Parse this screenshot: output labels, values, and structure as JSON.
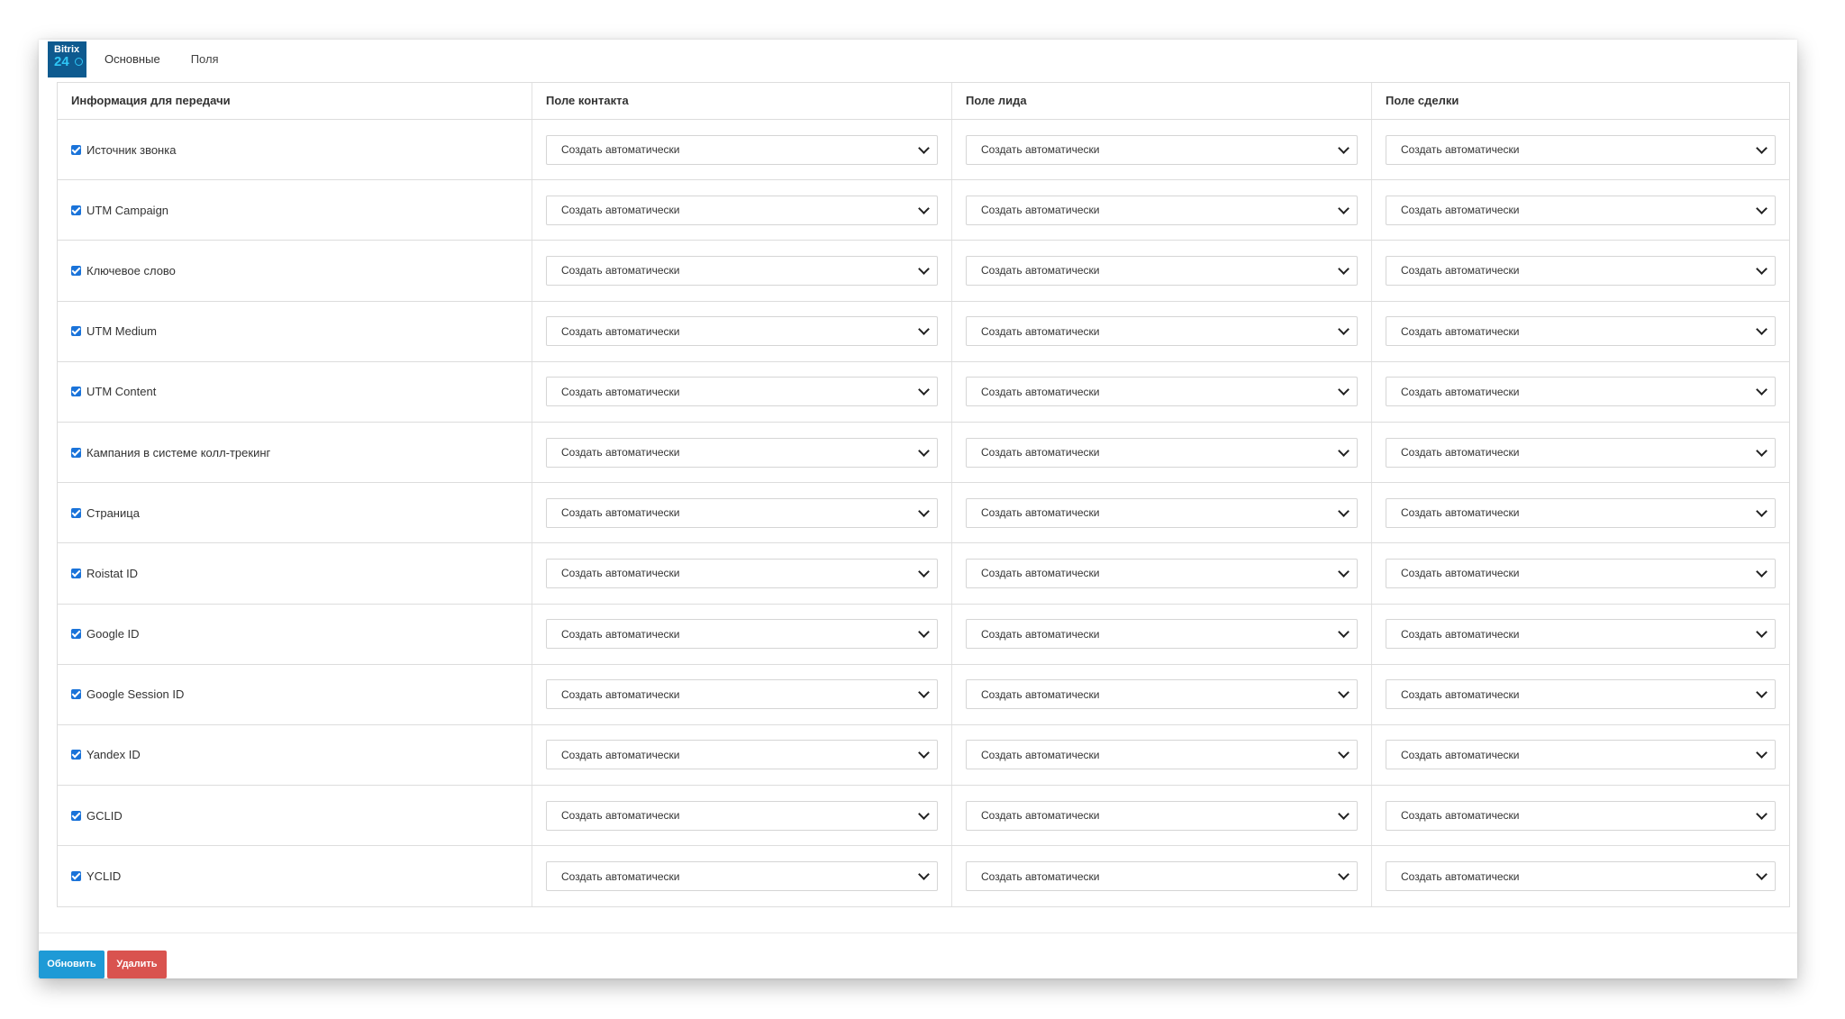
{
  "logo": {
    "line1": "Bitrix",
    "line2": "24"
  },
  "tabs": [
    {
      "label": "Основные"
    },
    {
      "label": "Поля"
    }
  ],
  "table": {
    "headers": [
      "Информация для передачи",
      "Поле контакта",
      "Поле лида",
      "Поле сделки"
    ],
    "rows": [
      {
        "label": "Источник звонка",
        "checked": true,
        "contact": "Создать автоматически",
        "lead": "Создать автоматически",
        "deal": "Создать автоматически"
      },
      {
        "label": "UTM Campaign",
        "checked": true,
        "contact": "Создать автоматически",
        "lead": "Создать автоматически",
        "deal": "Создать автоматически"
      },
      {
        "label": "Ключевое слово",
        "checked": true,
        "contact": "Создать автоматически",
        "lead": "Создать автоматически",
        "deal": "Создать автоматически"
      },
      {
        "label": "UTM Medium",
        "checked": true,
        "contact": "Создать автоматически",
        "lead": "Создать автоматически",
        "deal": "Создать автоматически"
      },
      {
        "label": "UTM Content",
        "checked": true,
        "contact": "Создать автоматически",
        "lead": "Создать автоматически",
        "deal": "Создать автоматически"
      },
      {
        "label": "Кампания в системе колл-трекинг",
        "checked": true,
        "contact": "Создать автоматически",
        "lead": "Создать автоматически",
        "deal": "Создать автоматически"
      },
      {
        "label": "Страница",
        "checked": true,
        "contact": "Создать автоматически",
        "lead": "Создать автоматически",
        "deal": "Создать автоматически"
      },
      {
        "label": "Roistat ID",
        "checked": true,
        "contact": "Создать автоматически",
        "lead": "Создать автоматически",
        "deal": "Создать автоматически"
      },
      {
        "label": "Google ID",
        "checked": true,
        "contact": "Создать автоматически",
        "lead": "Создать автоматически",
        "deal": "Создать автоматически"
      },
      {
        "label": "Google Session ID",
        "checked": true,
        "contact": "Создать автоматически",
        "lead": "Создать автоматически",
        "deal": "Создать автоматически"
      },
      {
        "label": "Yandex ID",
        "checked": true,
        "contact": "Создать автоматически",
        "lead": "Создать автоматически",
        "deal": "Создать автоматически"
      },
      {
        "label": "GCLID",
        "checked": true,
        "contact": "Создать автоматически",
        "lead": "Создать автоматически",
        "deal": "Создать автоматически"
      },
      {
        "label": "YCLID",
        "checked": true,
        "contact": "Создать автоматически",
        "lead": "Создать автоматически",
        "deal": "Создать автоматически"
      }
    ]
  },
  "buttons": {
    "update": "Обновить",
    "delete": "Удалить"
  },
  "colors": {
    "logo_bg": "#0e5a8f",
    "checkbox": "#1a73d9",
    "update_btn": "#1e9ad6",
    "delete_btn": "#d9534f"
  },
  "icons": {
    "dropdown": "chevron-down-icon",
    "checkbox": "checkbox-checked-icon"
  }
}
